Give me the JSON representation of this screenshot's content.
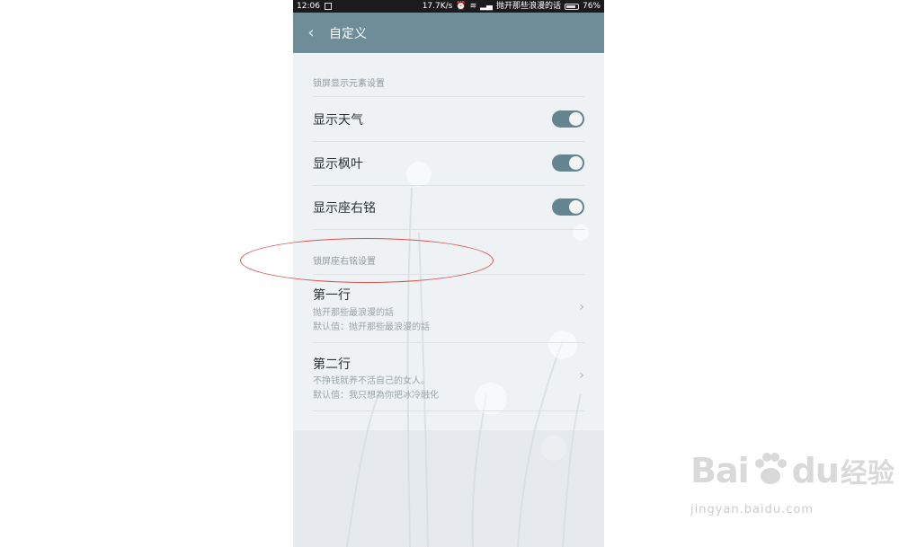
{
  "status_bar": {
    "time": "12:06",
    "network_speed": "17.7K/s",
    "carrier": "抛开那些浪漫的话",
    "battery": "76%"
  },
  "header": {
    "title": "自定义"
  },
  "section1": {
    "title": "锁屏显示元素设置",
    "items": [
      {
        "label": "显示天气",
        "enabled": true
      },
      {
        "label": "显示枫叶",
        "enabled": true
      },
      {
        "label": "显示座右铭",
        "enabled": true
      }
    ]
  },
  "section2": {
    "title": "锁屏座右铭设置",
    "items": [
      {
        "title": "第一行",
        "value": "抛开那些最浪漫的話",
        "default": "默认值：抛开那些最浪漫的話"
      },
      {
        "title": "第二行",
        "value": "不挣钱就养不活自己的女人。",
        "default": "默认值：我只想為你把冰冷融化"
      }
    ]
  },
  "watermark": {
    "brand": "Bai",
    "brand2": "du",
    "cn": "经验",
    "url": "jingyan.baidu.com"
  },
  "colors": {
    "app_bar": "#6f8c99",
    "toggle_on": "#64848f",
    "annotation": "#d9534f"
  }
}
